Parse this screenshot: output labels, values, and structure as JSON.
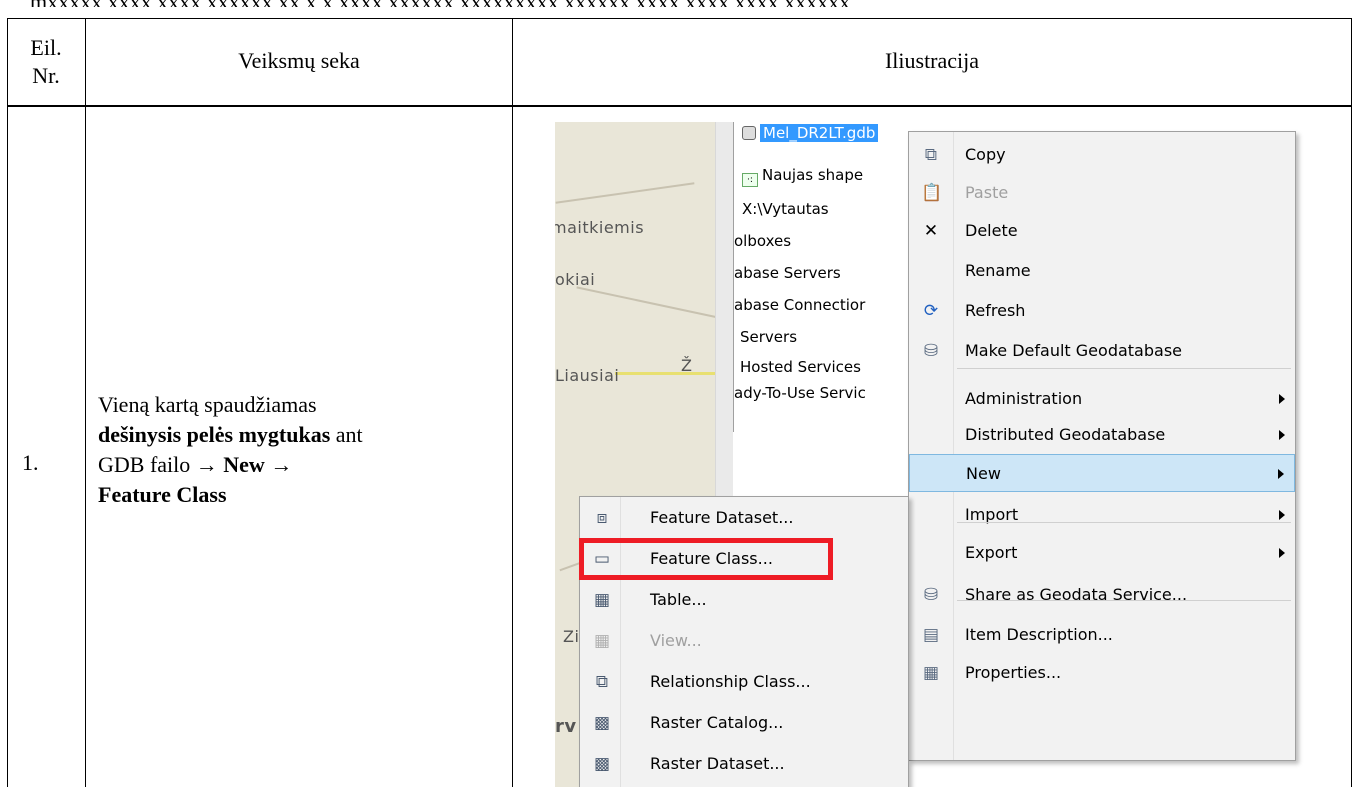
{
  "header": {
    "col_nr": "Eil.\nNr.",
    "col_steps": "Veiksmų seka",
    "col_illustration": "Iliustracija"
  },
  "row1": {
    "number": "1.",
    "step_prefix": "Vieną kartą spaudžiamas",
    "step_bold": "dešinysis pelės mygtukas",
    "step_mid": "ant GDB failo →",
    "step_new": "New",
    "step_arrow": "→",
    "step_feature_class": "Feature Class"
  },
  "map": {
    "labels": [
      "maitkiemis",
      "okiai",
      "Liausiai",
      "Ž",
      "Zi",
      "rv"
    ]
  },
  "tree": {
    "items": [
      "Mel_DR2LT.gdb",
      "Naujas shape",
      "X:\\Vytautas",
      "olboxes",
      "abase Servers",
      "abase Connectior",
      "Servers",
      "Hosted Services",
      "ady-To-Use Servic"
    ]
  },
  "context_menu": {
    "items": [
      {
        "label": "Copy",
        "icon": "copy-icon",
        "disabled": false,
        "submenu": false
      },
      {
        "label": "Paste",
        "icon": "paste-icon",
        "disabled": true,
        "submenu": false
      },
      {
        "label": "Delete",
        "icon": "delete-icon",
        "disabled": false,
        "submenu": false
      },
      {
        "label": "Rename",
        "icon": "",
        "disabled": false,
        "submenu": false
      },
      {
        "label": "Refresh",
        "icon": "refresh-icon",
        "disabled": false,
        "submenu": false
      },
      {
        "label": "Make Default Geodatabase",
        "icon": "default-geodatabase-icon",
        "disabled": false,
        "submenu": false
      },
      {
        "label": "Administration",
        "icon": "",
        "disabled": false,
        "submenu": true
      },
      {
        "label": "Distributed Geodatabase",
        "icon": "",
        "disabled": false,
        "submenu": true
      },
      {
        "label": "New",
        "icon": "",
        "disabled": false,
        "submenu": true,
        "highlighted": true
      },
      {
        "label": "Import",
        "icon": "",
        "disabled": false,
        "submenu": true
      },
      {
        "label": "Export",
        "icon": "",
        "disabled": false,
        "submenu": true
      },
      {
        "label": "Share as Geodata Service...",
        "icon": "share-geodata-icon",
        "disabled": false,
        "submenu": false
      },
      {
        "label": "Item Description...",
        "icon": "item-description-icon",
        "disabled": false,
        "submenu": false
      },
      {
        "label": "Properties...",
        "icon": "properties-icon",
        "disabled": false,
        "submenu": false
      }
    ]
  },
  "submenu": {
    "items": [
      {
        "label": "Feature Dataset...",
        "icon": "feature-dataset-icon",
        "disabled": false
      },
      {
        "label": "Feature Class...",
        "icon": "feature-class-icon",
        "disabled": false,
        "highlighted_box": true
      },
      {
        "label": "Table...",
        "icon": "table-icon",
        "disabled": false
      },
      {
        "label": "View...",
        "icon": "view-icon",
        "disabled": true
      },
      {
        "label": "Relationship Class...",
        "icon": "relationship-class-icon",
        "disabled": false
      },
      {
        "label": "Raster Catalog...",
        "icon": "raster-catalog-icon",
        "disabled": false
      },
      {
        "label": "Raster Dataset...",
        "icon": "raster-dataset-icon",
        "disabled": false
      }
    ]
  },
  "colors": {
    "highlight_box": "#ee1c25",
    "menu_highlight": "#cde6f7",
    "selection": "#3399ff"
  }
}
